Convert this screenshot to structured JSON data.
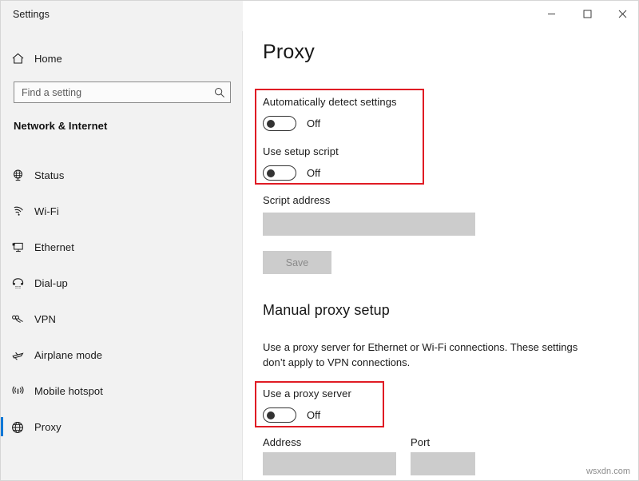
{
  "window": {
    "title": "Settings",
    "controls": [
      {
        "name": "minimize",
        "label": "–"
      },
      {
        "name": "maximize",
        "label": "□"
      },
      {
        "name": "close",
        "label": "✕"
      }
    ]
  },
  "sidebar": {
    "home": {
      "label": "Home",
      "icon": "home-icon"
    },
    "search": {
      "value": "",
      "placeholder": "Find a setting",
      "icon": "search-icon"
    },
    "category": "Network & Internet",
    "items": [
      {
        "label": "Status",
        "icon": "globe-status-icon",
        "selected": false
      },
      {
        "label": "Wi-Fi",
        "icon": "wifi-icon",
        "selected": false
      },
      {
        "label": "Ethernet",
        "icon": "ethernet-icon",
        "selected": false
      },
      {
        "label": "Dial-up",
        "icon": "dialup-phone-icon",
        "selected": false
      },
      {
        "label": "VPN",
        "icon": "vpn-icon",
        "selected": false
      },
      {
        "label": "Airplane mode",
        "icon": "airplane-icon",
        "selected": false
      },
      {
        "label": "Mobile hotspot",
        "icon": "hotspot-icon",
        "selected": false
      },
      {
        "label": "Proxy",
        "icon": "globe-proxy-icon",
        "selected": true
      }
    ]
  },
  "main": {
    "page_title": "Proxy",
    "automatic": {
      "detect": {
        "label": "Automatically detect settings",
        "state": "Off"
      },
      "setup_script": {
        "label": "Use setup script",
        "state": "Off"
      },
      "script_address": {
        "label": "Script address",
        "value": "",
        "placeholder": ""
      },
      "save_label": "Save"
    },
    "manual": {
      "heading": "Manual proxy setup",
      "description": "Use a proxy server for Ethernet or Wi-Fi connections. These settings don’t apply to VPN connections.",
      "use_proxy": {
        "label": "Use a proxy server",
        "state": "Off"
      },
      "address": {
        "label": "Address",
        "value": "",
        "placeholder": ""
      },
      "port": {
        "label": "Port",
        "value": "",
        "placeholder": ""
      }
    }
  },
  "highlights": {
    "color": "#e01b24",
    "boxes": [
      "automatic-proxy-setup",
      "use-a-proxy-server"
    ]
  },
  "watermark": "wsxdn.com",
  "colors": {
    "accent": "#0078d7",
    "sidebar_bg": "#f2f2f2",
    "content_bg": "#ffffff",
    "field_disabled": "#cccccc",
    "highlight": "#e01b24"
  }
}
